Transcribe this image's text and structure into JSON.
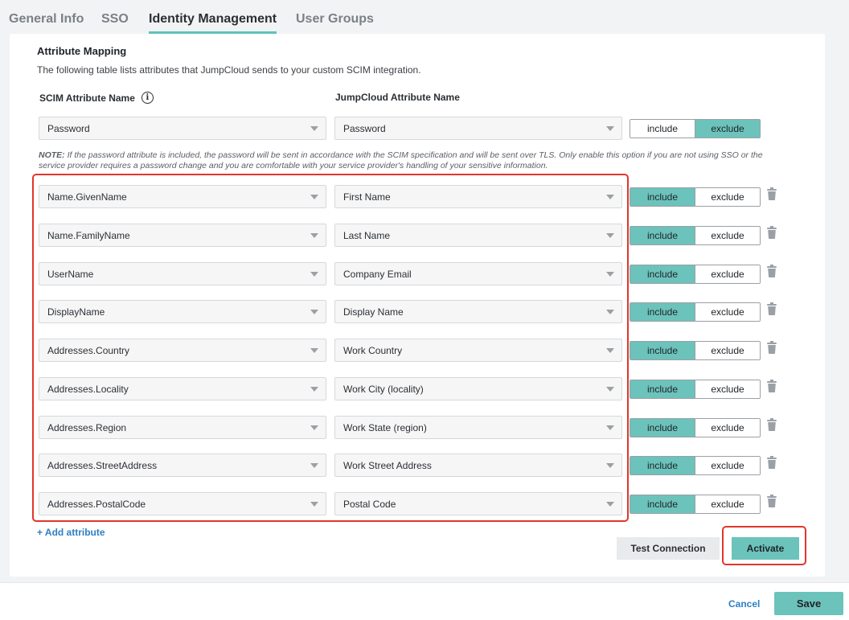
{
  "tabs": [
    {
      "label": "General Info",
      "active": false
    },
    {
      "label": "SSO",
      "active": false
    },
    {
      "label": "Identity Management",
      "active": true
    },
    {
      "label": "User Groups",
      "active": false
    }
  ],
  "section": {
    "title": "Attribute Mapping",
    "description": "The following table lists attributes that JumpCloud sends to your custom SCIM integration."
  },
  "columns": {
    "scim": "SCIM Attribute Name",
    "jumpcloud": "JumpCloud Attribute Name"
  },
  "toggle_labels": {
    "include": "include",
    "exclude": "exclude"
  },
  "password_row": {
    "scim": "Password",
    "jumpcloud": "Password",
    "state": "exclude"
  },
  "note": {
    "label": "NOTE:",
    "text": " If the password attribute is included, the password will be sent in accordance with the SCIM specification and will be sent over TLS. Only enable this option if you are not using SSO or the service provider requires a password change and you are comfortable with your service provider's handling of your sensitive information."
  },
  "rows": [
    {
      "scim": "Name.GivenName",
      "jumpcloud": "First Name",
      "state": "include"
    },
    {
      "scim": "Name.FamilyName",
      "jumpcloud": "Last Name",
      "state": "include"
    },
    {
      "scim": "UserName",
      "jumpcloud": "Company Email",
      "state": "include"
    },
    {
      "scim": "DisplayName",
      "jumpcloud": "Display Name",
      "state": "include"
    },
    {
      "scim": "Addresses.Country",
      "jumpcloud": "Work Country",
      "state": "include"
    },
    {
      "scim": "Addresses.Locality",
      "jumpcloud": "Work City (locality)",
      "state": "include"
    },
    {
      "scim": "Addresses.Region",
      "jumpcloud": "Work State (region)",
      "state": "include"
    },
    {
      "scim": "Addresses.StreetAddress",
      "jumpcloud": "Work Street Address",
      "state": "include"
    },
    {
      "scim": "Addresses.PostalCode",
      "jumpcloud": "Postal Code",
      "state": "include"
    }
  ],
  "actions": {
    "add_attribute": "+ Add attribute",
    "test_connection": "Test Connection",
    "activate": "Activate"
  },
  "footer": {
    "cancel": "Cancel",
    "save": "Save"
  },
  "colors": {
    "accent": "#6cc3bb",
    "highlight": "#e2362c",
    "link": "#2f7fc1"
  }
}
